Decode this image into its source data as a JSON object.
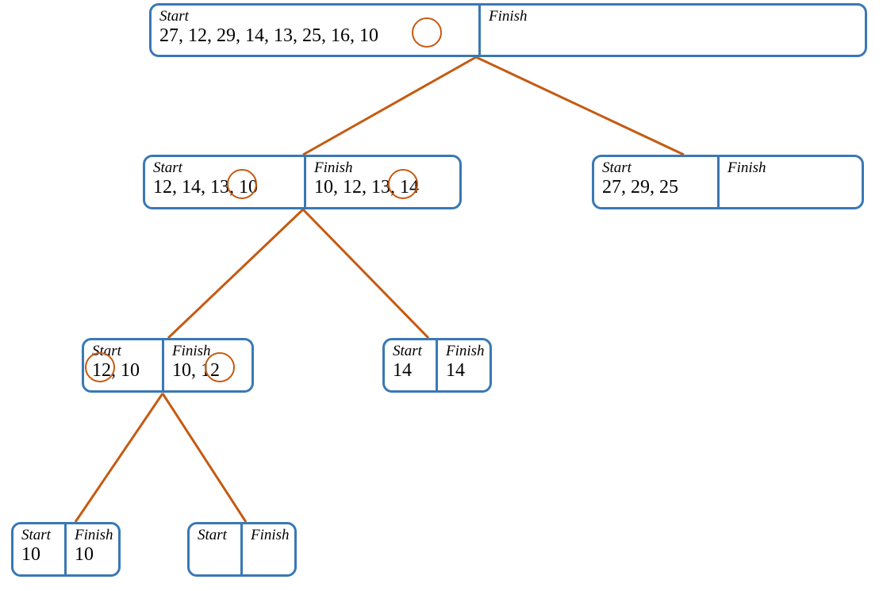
{
  "labels": {
    "start": "Start",
    "finish": "Finish"
  },
  "nodes": {
    "root": {
      "start": "27, 12, 29, 14, 13, 25, 16, 10",
      "finish": ""
    },
    "left1": {
      "start": "12, 14, 13, 10",
      "finish": "10, 12, 13, 14"
    },
    "right1": {
      "start": "27, 29, 25",
      "finish": ""
    },
    "ll2": {
      "start": "12, 10",
      "finish": "10, 12"
    },
    "lr2": {
      "start": "14",
      "finish": "14"
    },
    "lll3": {
      "start": "10",
      "finish": "10"
    },
    "llr3": {
      "start": "",
      "finish": ""
    }
  },
  "circled": {
    "root_start_16": "16",
    "left1_start_13": "13",
    "left1_finish_13": "13",
    "ll2_start_12": "12",
    "ll2_finish_12": "12"
  }
}
